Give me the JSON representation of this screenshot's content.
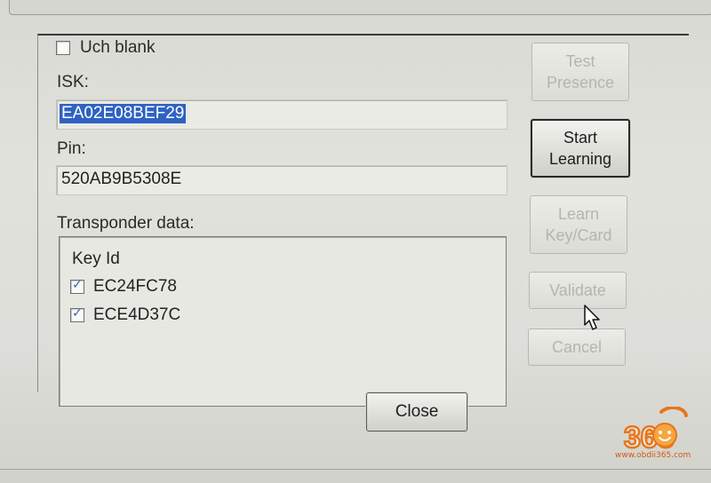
{
  "dialog": {
    "uch_blank": {
      "label": "Uch blank",
      "checked": false
    },
    "isk": {
      "label": "ISK:",
      "value": "EA02E08BEF29"
    },
    "pin": {
      "label": "Pin:",
      "value": "520AB9B5308E"
    },
    "transponder": {
      "label": "Transponder data:",
      "column_header": "Key Id",
      "keys": [
        {
          "id": "EC24FC78",
          "checked": true
        },
        {
          "id": "ECE4D37C",
          "checked": true
        }
      ]
    }
  },
  "buttons": {
    "test_presence": {
      "line1": "Test",
      "line2": "Presence",
      "enabled": false
    },
    "start_learning": {
      "line1": "Start",
      "line2": "Learning",
      "enabled": true
    },
    "learn_key_card": {
      "line1": "Learn",
      "line2": "Key/Card",
      "enabled": false
    },
    "validate": {
      "label": "Validate",
      "enabled": false
    },
    "cancel": {
      "label": "Cancel",
      "enabled": false
    },
    "close": {
      "label": "Close",
      "enabled": true
    }
  },
  "watermark": {
    "logo_text": "365",
    "url": "www.obdii365.com"
  },
  "colors": {
    "selection": "#2f62c2",
    "disabled_text": "#b5b5b0",
    "logo_orange": "#e8761a"
  }
}
